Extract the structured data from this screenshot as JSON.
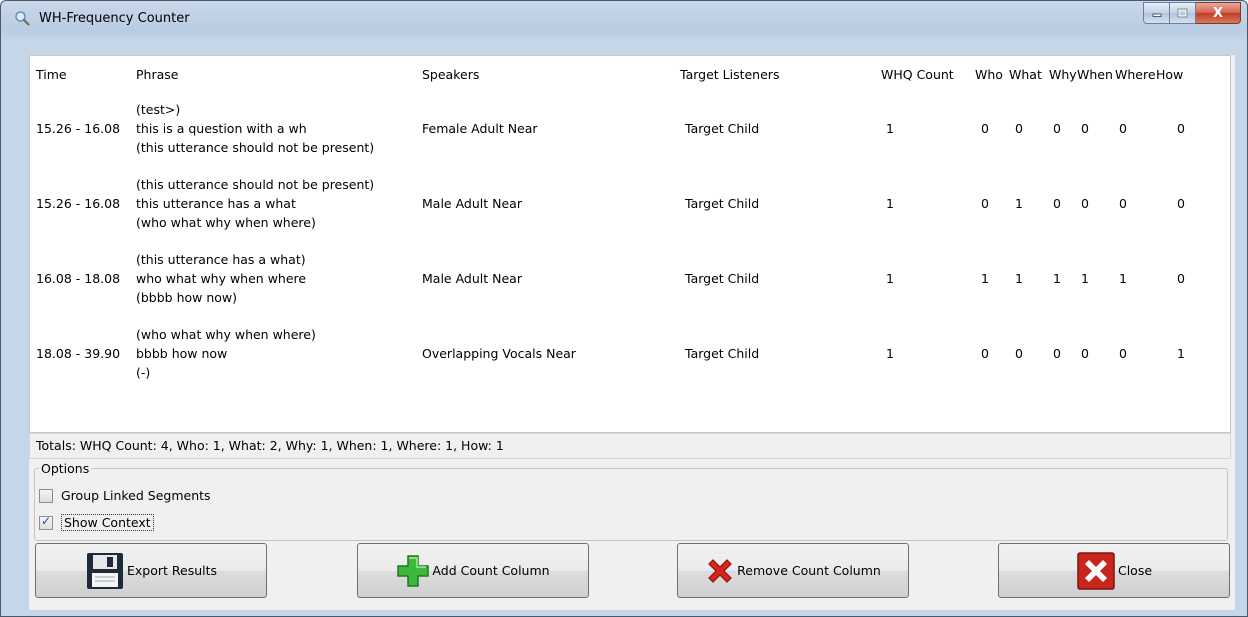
{
  "window": {
    "title": "WH-Frequency Counter",
    "close_glyph": "X"
  },
  "columns": [
    "Time",
    "Phrase",
    "Speakers",
    "Target Listeners",
    "WHQ Count",
    "Who",
    "What",
    "Why",
    "When",
    "Where",
    "How"
  ],
  "rows": [
    {
      "time": "15.26 - 16.08",
      "phrase": [
        "(test>)",
        "this is a question with a wh",
        "(this utterance should not be present)"
      ],
      "speakers": "Female Adult Near",
      "listeners": "Target Child",
      "whq": "1",
      "who": "0",
      "what": "0",
      "why": "0",
      "when": "0",
      "where": "0",
      "how": "0"
    },
    {
      "time": "15.26 - 16.08",
      "phrase": [
        "(this utterance should not be present)",
        "this utterance has a what",
        "(who what why when where)"
      ],
      "speakers": "Male Adult Near",
      "listeners": "Target Child",
      "whq": "1",
      "who": "0",
      "what": "1",
      "why": "0",
      "when": "0",
      "where": "0",
      "how": "0"
    },
    {
      "time": "16.08 - 18.08",
      "phrase": [
        "(this utterance has a what)",
        "who what why when where",
        "(bbbb how now)"
      ],
      "speakers": "Male Adult Near",
      "listeners": "Target Child",
      "whq": "1",
      "who": "1",
      "what": "1",
      "why": "1",
      "when": "1",
      "where": "1",
      "how": "0"
    },
    {
      "time": "18.08 - 39.90",
      "phrase": [
        "(who what why when where)",
        "bbbb how now",
        "(-)"
      ],
      "speakers": "Overlapping Vocals Near",
      "listeners": "Target Child",
      "whq": "1",
      "who": "0",
      "what": "0",
      "why": "0",
      "when": "0",
      "where": "0",
      "how": "1"
    }
  ],
  "totals": "Totals: WHQ Count: 4, Who: 1, What: 2, Why: 1, When: 1, Where: 1, How: 1",
  "options": {
    "legend": "Options",
    "group_linked": {
      "label": "Group Linked Segments",
      "checked": false
    },
    "show_context": {
      "label": "Show Context",
      "checked": true
    }
  },
  "buttons": {
    "export": "Export Results",
    "add": "Add Count Column",
    "remove": "Remove Count Column",
    "close": "Close"
  },
  "icons": {
    "title": "magnifier-icon",
    "export": "floppy-disk-icon",
    "add": "green-plus-icon",
    "remove": "red-x-icon",
    "close": "close-box-icon"
  }
}
